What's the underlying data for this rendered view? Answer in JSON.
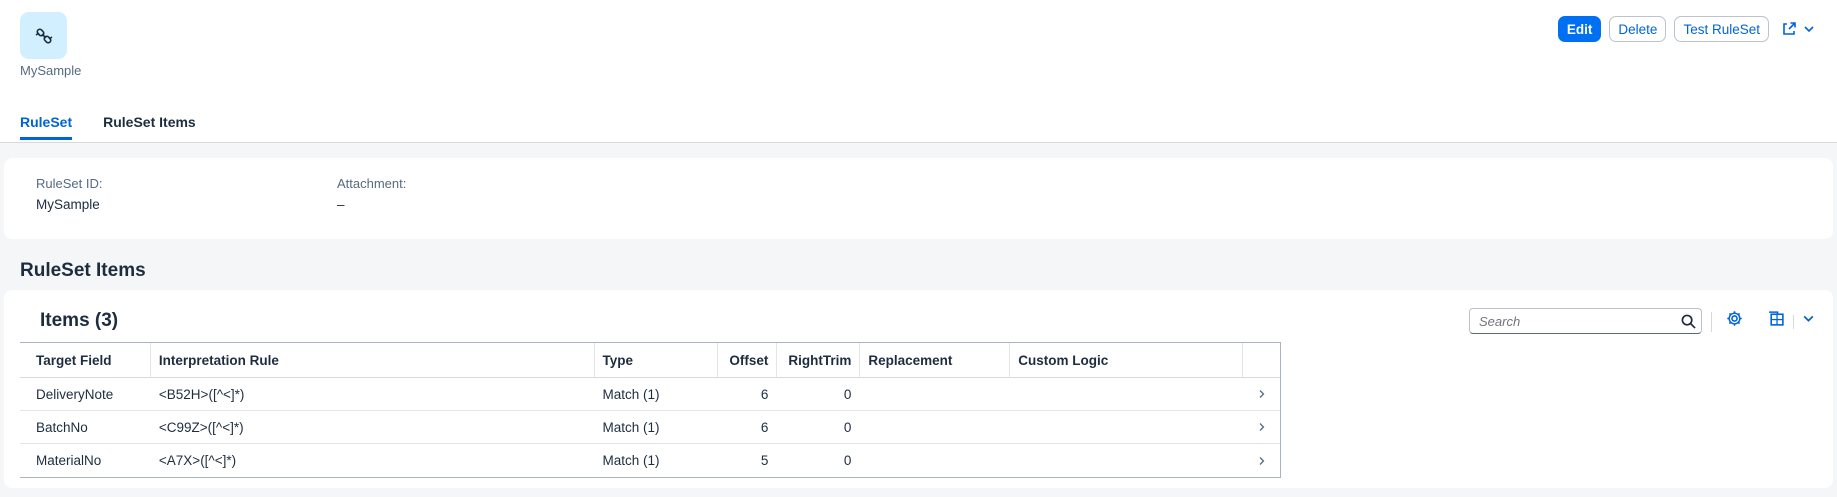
{
  "app": {
    "name": "MySample",
    "icon": "chain-link-icon"
  },
  "actions": {
    "edit": "Edit",
    "delete": "Delete",
    "test": "Test RuleSet",
    "share_icon": "share-icon",
    "more_icon": "chevron-down-icon"
  },
  "tabs": [
    {
      "label": "RuleSet",
      "active": true
    },
    {
      "label": "RuleSet Items",
      "active": false
    }
  ],
  "form": {
    "ruleset_id_label": "RuleSet ID:",
    "ruleset_id_value": "MySample",
    "attachment_label": "Attachment:",
    "attachment_value": "–"
  },
  "section": {
    "title": "RuleSet Items"
  },
  "table": {
    "title": "Items (3)",
    "search_placeholder": "Search",
    "columns": [
      "Target Field",
      "Interpretation Rule",
      "Type",
      "Offset",
      "RightTrim",
      "Replacement",
      "Custom Logic"
    ],
    "rows": [
      {
        "target": "DeliveryNote",
        "rule": "<B52H>([^<]*)",
        "type": "Match (1)",
        "offset": "6",
        "righttrim": "0",
        "replacement": "",
        "custom": ""
      },
      {
        "target": "BatchNo",
        "rule": "<C99Z>([^<]*)",
        "type": "Match (1)",
        "offset": "6",
        "righttrim": "0",
        "replacement": "",
        "custom": ""
      },
      {
        "target": "MaterialNo",
        "rule": "<A7X>([^<]*)",
        "type": "Match (1)",
        "offset": "5",
        "righttrim": "0",
        "replacement": "",
        "custom": ""
      }
    ]
  },
  "colors": {
    "accent": "#0070f2",
    "link": "#0064d9",
    "icon_tile": "#d1efff"
  }
}
